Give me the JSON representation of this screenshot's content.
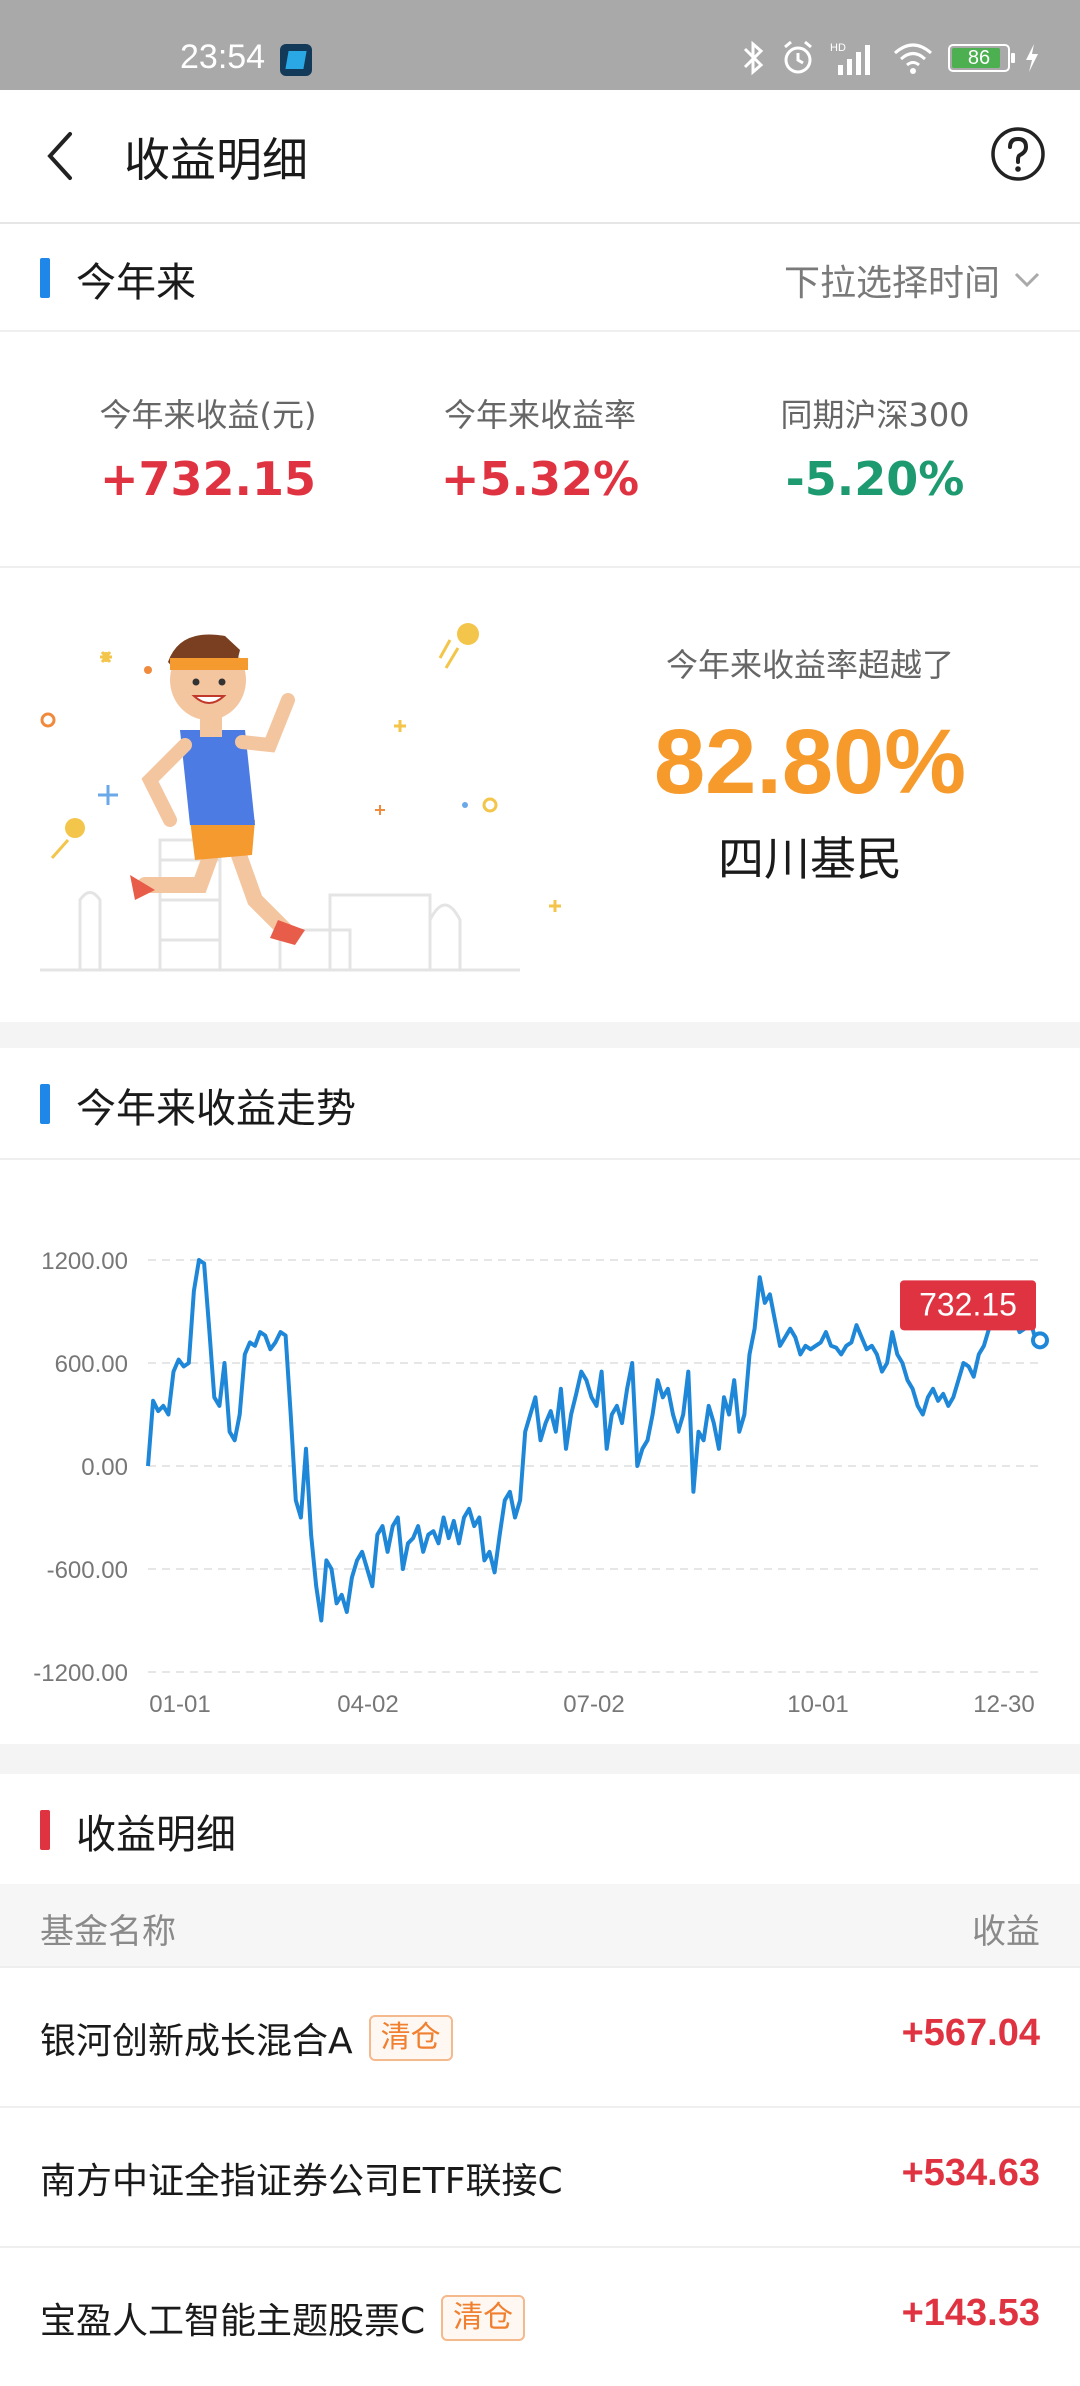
{
  "status_bar": {
    "time": "23:54",
    "battery": "86"
  },
  "nav": {
    "title": "收益明细"
  },
  "summary": {
    "section_label": "今年来",
    "time_picker_label": "下拉选择时间",
    "stats": [
      {
        "caption": "今年来收益(元)",
        "value": "+732.15",
        "color": "#e03341"
      },
      {
        "caption": "今年来收益率",
        "value": "+5.32%",
        "color": "#e03341"
      },
      {
        "caption": "同期沪深300",
        "value": "-5.20%",
        "color": "#1d9a70"
      }
    ]
  },
  "ranking": {
    "caption": "今年来收益率超越了",
    "percent": "82.80%",
    "region": "四川基民"
  },
  "trend": {
    "section_label": "今年来收益走势"
  },
  "chart_data": {
    "type": "line",
    "y_ticks": [
      "1200.00",
      "600.00",
      "0.00",
      "-600.00",
      "-1200.00"
    ],
    "x_ticks": [
      "01-01",
      "04-02",
      "07-02",
      "10-01",
      "12-30"
    ],
    "ylim": [
      -1200,
      1200
    ],
    "grid": true,
    "line_color": "#1f87d8",
    "latest_label": "732.15",
    "series": [
      {
        "values": [
          0,
          380,
          320,
          350,
          300,
          550,
          620,
          580,
          600,
          1020,
          1200,
          1180,
          800,
          400,
          350,
          600,
          200,
          150,
          300,
          650,
          720,
          700,
          780,
          760,
          680,
          720,
          780,
          760,
          300,
          -200,
          -300,
          100,
          -400,
          -700,
          -900,
          -550,
          -600,
          -800,
          -750,
          -850,
          -650,
          -550,
          -500,
          -600,
          -700,
          -400,
          -350,
          -500,
          -350,
          -300,
          -600,
          -450,
          -420,
          -350,
          -500,
          -400,
          -380,
          -450,
          -300,
          -420,
          -320,
          -450,
          -300,
          -250,
          -350,
          -300,
          -550,
          -500,
          -620,
          -400,
          -200,
          -150,
          -300,
          -200,
          200,
          300,
          400,
          150,
          250,
          320,
          200,
          450,
          100,
          300,
          420,
          550,
          500,
          400,
          350,
          550,
          100,
          300,
          350,
          250,
          450,
          600,
          0,
          100,
          150,
          300,
          500,
          400,
          450,
          300,
          200,
          300,
          550,
          -150,
          200,
          150,
          350,
          250,
          100,
          400,
          300,
          500,
          200,
          300,
          650,
          800,
          1100,
          950,
          1000,
          850,
          700,
          750,
          800,
          750,
          650,
          700,
          680,
          700,
          720,
          780,
          700,
          690,
          650,
          700,
          720,
          820,
          750,
          680,
          700,
          650,
          550,
          600,
          780,
          650,
          600,
          500,
          450,
          350,
          300,
          400,
          450,
          380,
          420,
          350,
          400,
          500,
          600,
          580,
          520,
          650,
          700,
          800,
          900,
          1050,
          980,
          900,
          850,
          780,
          800,
          860,
          750,
          732.15
        ]
      }
    ]
  },
  "detail": {
    "section_label": "收益明细",
    "col_name": "基金名称",
    "col_gain": "收益",
    "rows": [
      {
        "name": "银河创新成长混合A",
        "tag": "清仓",
        "gain": "+567.04"
      },
      {
        "name": "南方中证全指证券公司ETF联接C",
        "tag": "",
        "gain": "+534.63"
      },
      {
        "name": "宝盈人工智能主题股票C",
        "tag": "清仓",
        "gain": "+143.53"
      }
    ]
  }
}
